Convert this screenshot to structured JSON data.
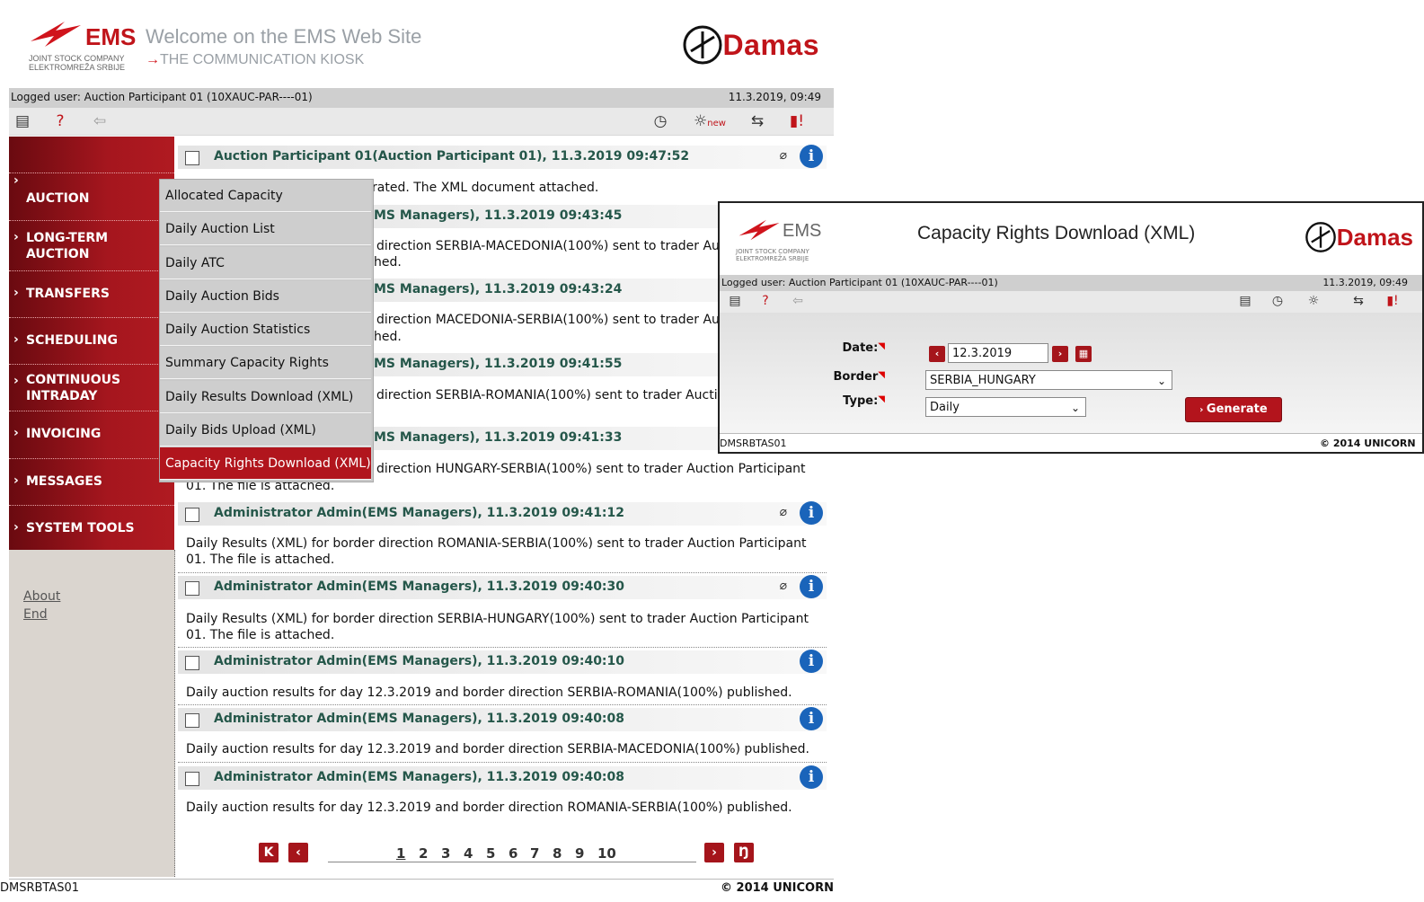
{
  "header": {
    "ems_brand": "EMS",
    "ems_subtitle": "JOINT STOCK COMPANY ELEKTROMREŽA SRBIJE",
    "welcome": "Welcome on the EMS Web Site",
    "kiosk": "THE COMMUNICATION KIOSK",
    "damas": "Damas"
  },
  "userbar": {
    "logged_user": "Logged user: Auction Participant 01 (10XAUC-PAR----01)",
    "datetime": "11.3.2019, 09:49"
  },
  "toolbar": {
    "left_icons": [
      "document-icon",
      "help-icon",
      "back-arrow-icon"
    ],
    "right_icons": [
      "clock-icon",
      "new-bulb-icon",
      "transfer-icon",
      "alert-book-icon"
    ],
    "new_badge": "new"
  },
  "sidebar": {
    "items": [
      {
        "label": "AUCTION"
      },
      {
        "label": "LONG-TERM AUCTION"
      },
      {
        "label": "TRANSFERS"
      },
      {
        "label": "SCHEDULING"
      },
      {
        "label": "CONTINUOUS INTRADAY"
      },
      {
        "label": "INVOICING"
      },
      {
        "label": "MESSAGES"
      },
      {
        "label": "SYSTEM TOOLS"
      }
    ],
    "links": {
      "about": "About",
      "end": "End"
    }
  },
  "dropdown": {
    "items": [
      "Allocated Capacity",
      "Daily Auction List",
      "Daily ATC",
      "Daily Auction Bids",
      "Daily Auction Statistics",
      "Summary Capacity Rights",
      "Daily Results Download (XML)",
      "Daily Bids Upload (XML)",
      "Capacity Rights Download (XML)"
    ],
    "active": "Capacity Rights Download (XML)"
  },
  "messages": [
    {
      "title": "Auction Participant 01(Auction Participant 01), 11.3.2019 09:47:52",
      "body": "rated. The XML document attached.",
      "attachment": true
    },
    {
      "title": "MS Managers), 11.3.2019 09:43:45",
      "body": "direction SERBIA-MACEDONIA(100%) sent to trader Au",
      "body2": "hed.",
      "attachment": false
    },
    {
      "title": "MS Managers), 11.3.2019 09:43:24",
      "body": "direction MACEDONIA-SERBIA(100%) sent to trader Au",
      "body2": "hed.",
      "attachment": false
    },
    {
      "title": "MS Managers), 11.3.2019 09:41:55",
      "body": "direction SERBIA-ROMANIA(100%) sent to trader Aucti",
      "attachment": false
    },
    {
      "title": "MS Managers), 11.3.2019 09:41:33",
      "body": "direction HUNGARY-SERBIA(100%) sent to trader Auction Participant",
      "body2": "01. The file is attached.",
      "attachment": false
    },
    {
      "title": "Administrator Admin(EMS Managers), 11.3.2019 09:41:12",
      "body": "Daily Results (XML) for border direction ROMANIA-SERBIA(100%) sent to trader Auction Participant",
      "body2": "01. The file is attached.",
      "attachment": true
    },
    {
      "title": "Administrator Admin(EMS Managers), 11.3.2019 09:40:30",
      "body": "Daily Results (XML) for border direction SERBIA-HUNGARY(100%) sent to trader Auction Participant",
      "body2": "01. The file is attached.",
      "attachment": true
    },
    {
      "title": "Administrator Admin(EMS Managers), 11.3.2019 09:40:10",
      "body": "Daily auction results for day 12.3.2019 and border direction SERBIA-ROMANIA(100%) published.",
      "attachment": false
    },
    {
      "title": "Administrator Admin(EMS Managers), 11.3.2019 09:40:08",
      "body": "Daily auction results for day 12.3.2019 and border direction SERBIA-MACEDONIA(100%) published.",
      "attachment": false
    },
    {
      "title": "Administrator Admin(EMS Managers), 11.3.2019 09:40:08",
      "body": "Daily auction results for day 12.3.2019 and border direction ROMANIA-SERBIA(100%) published.",
      "attachment": false
    }
  ],
  "pagination": {
    "pages": [
      "1",
      "2",
      "3",
      "4",
      "5",
      "6",
      "7",
      "8",
      "9",
      "10"
    ],
    "current": "1"
  },
  "footer": {
    "left": "DMSRBTAS01",
    "right": "© 2014 UNICORN"
  },
  "popup": {
    "title": "Capacity Rights Download (XML)",
    "logged_user": "Logged user: Auction Participant 01 (10XAUC-PAR----01)",
    "datetime": "11.3.2019, 09:49",
    "form": {
      "date_label": "Date:",
      "date_value": "12.3.2019",
      "border_label": "Border",
      "border_value": "SERBIA_HUNGARY",
      "type_label": "Type:",
      "type_value": "Daily",
      "generate_label": "Generate"
    },
    "footer_left": "DMSRBTAS01",
    "footer_right": "© 2014 UNICORN"
  },
  "colors": {
    "brand_red": "#b01a21",
    "message_title": "#25574a",
    "info_blue": "#1a64ba"
  }
}
